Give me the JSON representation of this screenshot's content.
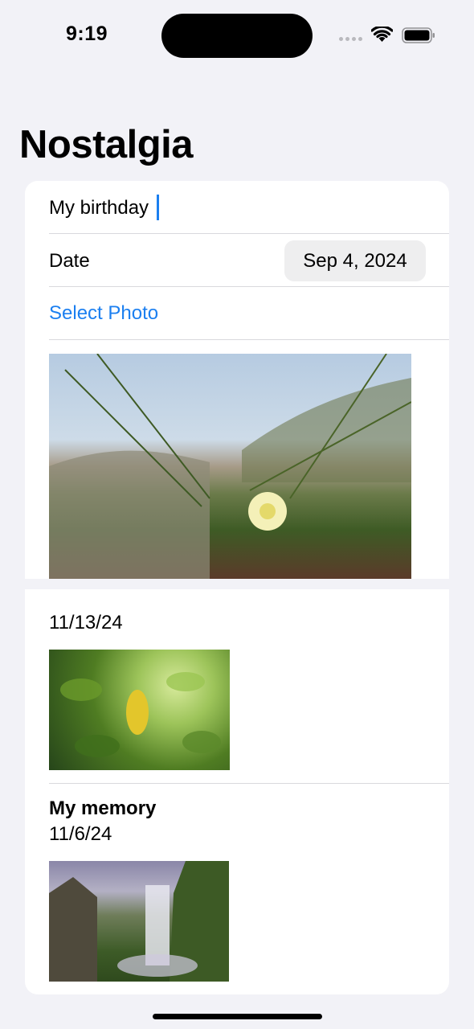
{
  "status_bar": {
    "time": "9:19"
  },
  "nav": {
    "title": "Nostalgia"
  },
  "form": {
    "title_value": "My birthday",
    "date_label": "Date",
    "date_value": "Sep 4, 2024",
    "select_photo_label": "Select Photo"
  },
  "memories": [
    {
      "title": "",
      "date": "11/13/24",
      "photo_icon": "leaf-photo"
    },
    {
      "title": "My memory",
      "date": "11/6/24",
      "photo_icon": "waterfall-photo"
    }
  ],
  "colors": {
    "accent": "#1b7ff0",
    "background": "#f2f2f7",
    "card": "#ffffff",
    "pill": "#eeeeef"
  }
}
